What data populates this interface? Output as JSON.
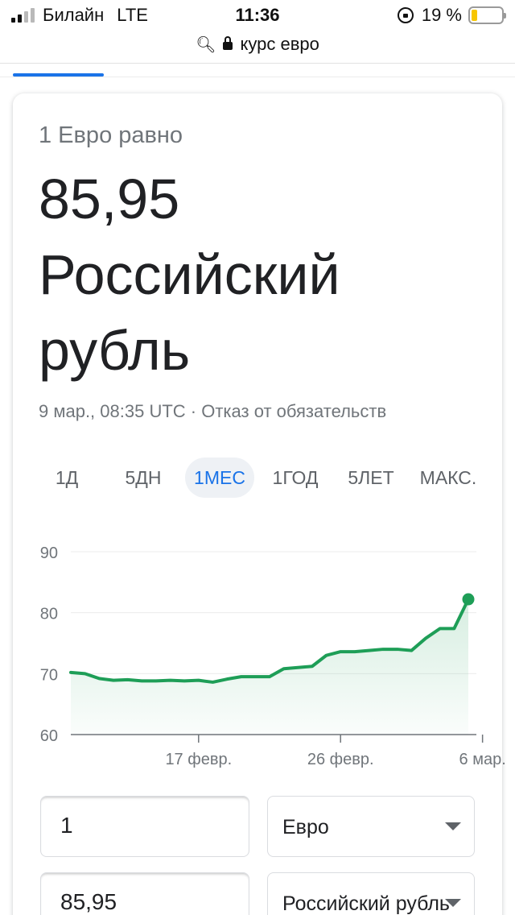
{
  "status_bar": {
    "carrier": "Билайн",
    "network": "LTE",
    "time": "11:36",
    "battery": "19 %",
    "battery_level": 0.19,
    "battery_color": "#f7c600"
  },
  "url_bar": {
    "query": "курс евро"
  },
  "converter_header": {
    "subtitle": "1 Евро равно",
    "value": "85,95",
    "currency": "Российский рубль",
    "meta": "9 мар., 08:35 UTC · Отказ от обязательств"
  },
  "ranges": [
    "1Д",
    "5ДН",
    "1МЕС",
    "1ГОД",
    "5ЛЕТ",
    "МАКС."
  ],
  "active_range": "1МЕС",
  "colors": {
    "accent": "#1a73e8",
    "line": "#1e9e57",
    "fill": "#e6f4ec"
  },
  "chart_data": {
    "type": "area",
    "title": "",
    "xlabel": "",
    "ylabel": "",
    "ylim": [
      60,
      90
    ],
    "yticks": [
      60,
      70,
      80,
      90
    ],
    "xticks": [
      {
        "label": "17 февр.",
        "index": 9
      },
      {
        "label": "26 февр.",
        "index": 19
      },
      {
        "label": "6 мар.",
        "index": 29
      }
    ],
    "grid": true,
    "series": [
      {
        "values": [
          70.2,
          70.0,
          69.2,
          68.9,
          69.0,
          68.8,
          68.8,
          68.9,
          68.8,
          68.9,
          68.6,
          69.1,
          69.5,
          69.5,
          69.5,
          70.8,
          71.0,
          71.2,
          73.0,
          73.6,
          73.6,
          73.8,
          74.0,
          74.0,
          73.8,
          75.8,
          77.4,
          77.4,
          82.2
        ]
      }
    ]
  },
  "converter": {
    "from_amount": "1",
    "from_currency": "Евро",
    "to_amount": "85,95",
    "to_currency": "Российский рубль"
  }
}
